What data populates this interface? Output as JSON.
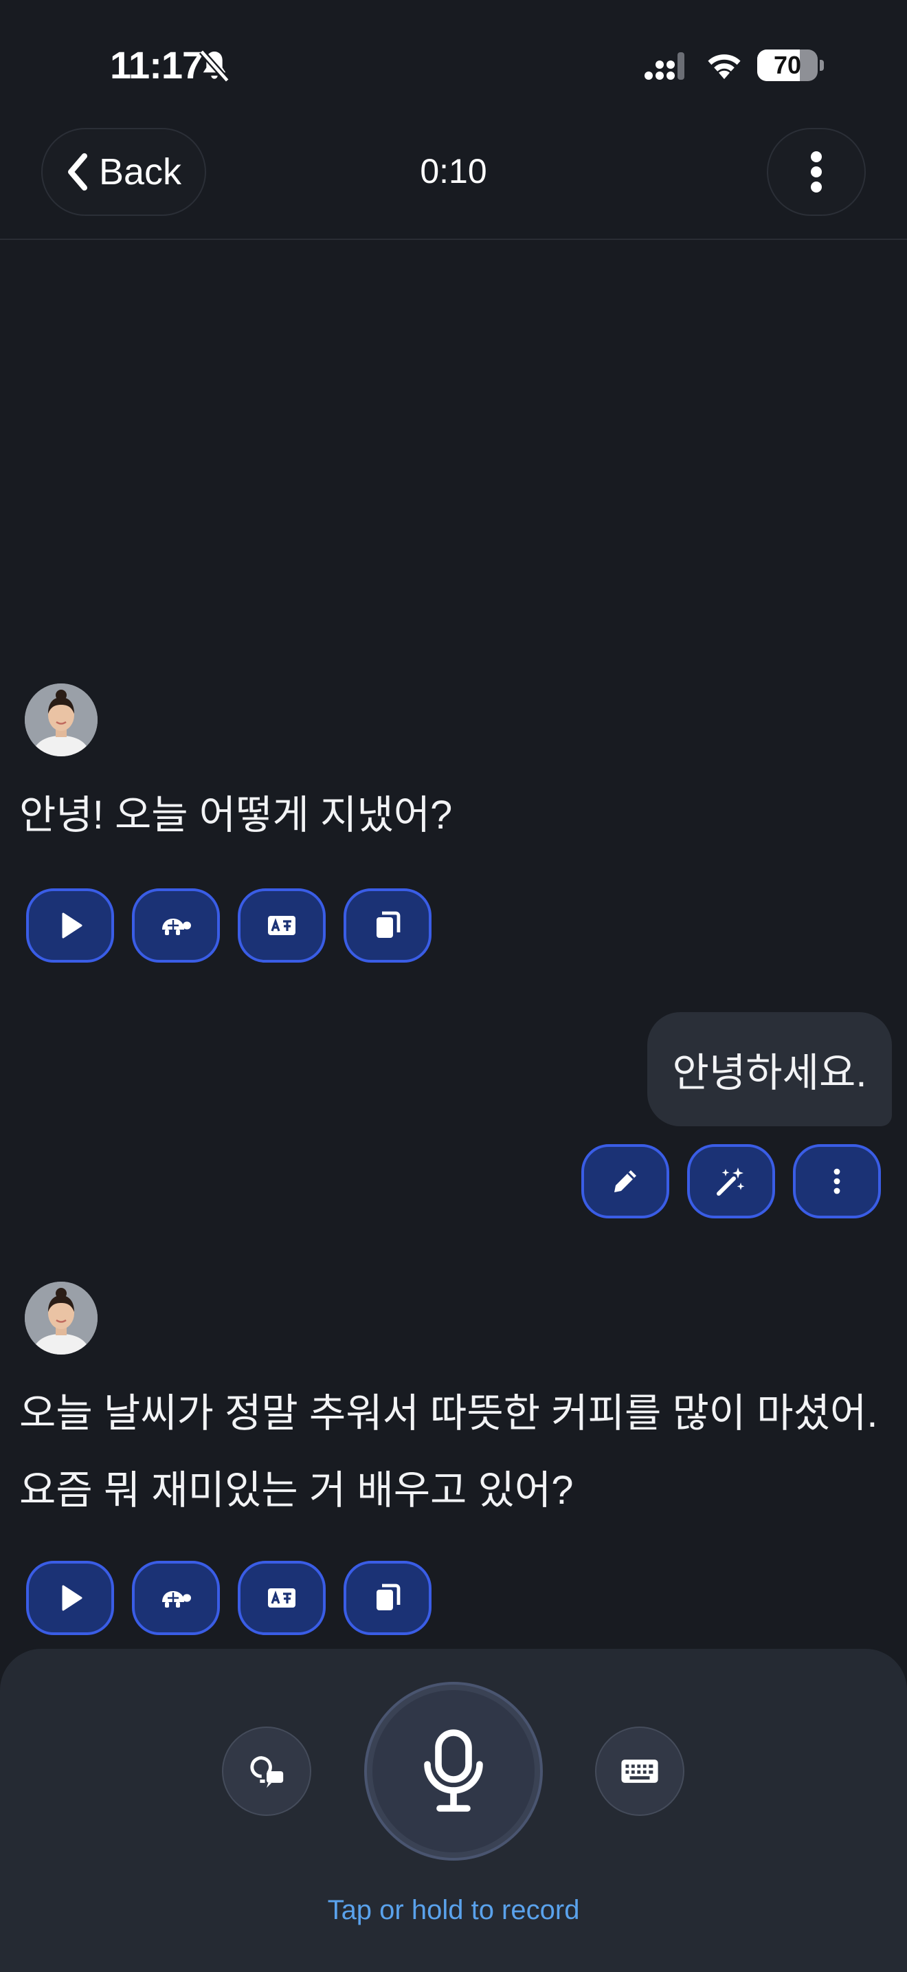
{
  "status_bar": {
    "time": "11:17",
    "battery_level": "70",
    "battery_fraction": 0.7,
    "icons": [
      "bell-slash-icon",
      "cellular-signal-icon",
      "wifi-icon",
      "battery-icon"
    ]
  },
  "header": {
    "back_label": "Back",
    "timer": "0:10",
    "icons": [
      "chevron-left-icon",
      "vertical-ellipsis-icon"
    ]
  },
  "conversation": {
    "messages": [
      {
        "role": "assistant",
        "lines": [
          "안녕! 오늘 어떻게 지냈어?"
        ],
        "actions": [
          "play-icon",
          "turtle-slow-icon",
          "translate-icon",
          "copy-icon"
        ]
      },
      {
        "role": "user",
        "text": "안녕하세요.",
        "actions": [
          "pencil-edit-icon",
          "magic-wand-icon",
          "vertical-ellipsis-icon"
        ]
      },
      {
        "role": "assistant",
        "lines": [
          "오늘 날씨가 정말 추워서 따뜻한 커피를 많이 마셨어.",
          "요즘 뭐 재미있는 거 배우고 있어?"
        ],
        "actions": [
          "play-icon",
          "turtle-slow-icon",
          "translate-icon",
          "copy-icon"
        ]
      }
    ]
  },
  "input_panel": {
    "hint": "Tap or hold to record",
    "icons": [
      "hint-bulb-icon",
      "microphone-icon",
      "keyboard-icon"
    ]
  },
  "colors": {
    "background": "#181b21",
    "action_fill": "#1b3275",
    "action_border": "#3a5de6",
    "hint_text": "#5aa2ec",
    "panel": "#252a33"
  }
}
